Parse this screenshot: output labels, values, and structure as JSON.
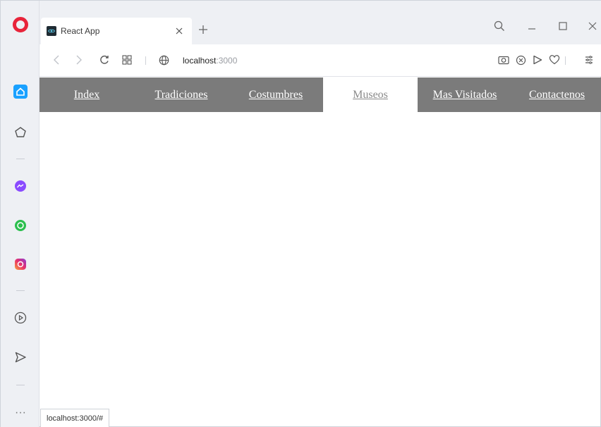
{
  "browser": {
    "tab": {
      "title": "React App"
    },
    "url": {
      "host": "localhost",
      "port": ":3000"
    },
    "status_url": "localhost:3000/#",
    "colors": {
      "opera_red": "#e8243a",
      "sidebar_active": "#1aa1ff",
      "nav_bg": "#7b7b7b"
    },
    "sidebar_icons": [
      "home-icon",
      "bookmarks-icon",
      "messenger-icon",
      "whatsapp-icon",
      "instagram-icon",
      "player-icon",
      "flow-icon",
      "more-icon"
    ],
    "more_label": "···"
  },
  "nav": {
    "items": [
      {
        "label": "Index"
      },
      {
        "label": "Tradiciones"
      },
      {
        "label": "Costumbres"
      },
      {
        "label": "Museos",
        "active": true
      },
      {
        "label": "Mas Visitados"
      },
      {
        "label": "Contactenos"
      }
    ]
  }
}
